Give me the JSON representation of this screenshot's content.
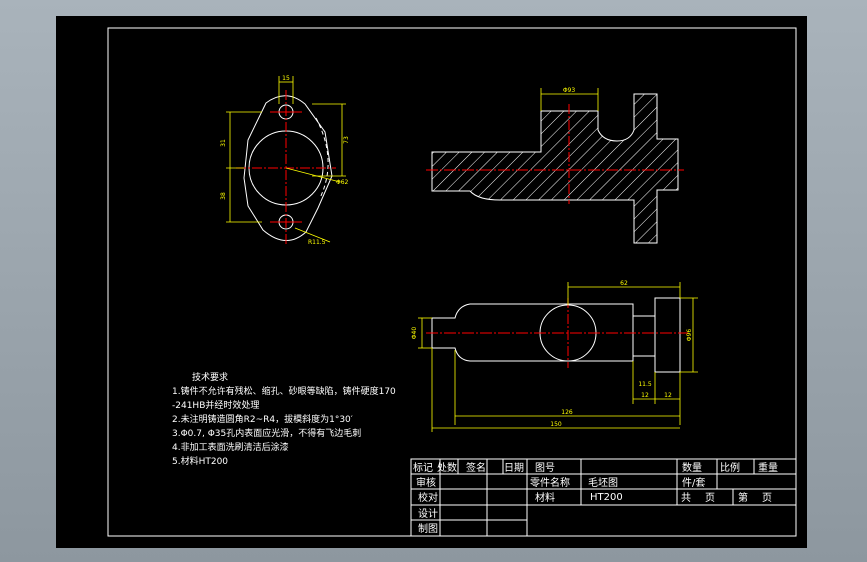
{
  "colors": {
    "paper": "#000000",
    "frame": "#ffffff",
    "hatch": "#ffffff",
    "dim": "#ffff00",
    "center": "#ff0000",
    "text": "#ffffff"
  },
  "dims": {
    "top_width": "15",
    "left_upper": "31",
    "left_lower": "38",
    "right_height": "73",
    "dia_label": "Φ62",
    "r_label": "R11.5",
    "sec_width": "Φ93",
    "top_62": "62",
    "left_dia": "Φ40",
    "right_dia": "Φ96",
    "dim_115": "11.5",
    "dim_12a": "12",
    "dim_12b": "12",
    "dim_126": "126",
    "dim_150": "150"
  },
  "notes": {
    "title": "技术要求",
    "lines": [
      "1.铸件不允许有残松、缩孔、砂眼等缺陷，铸件硬度170",
      "-241HB并经时效处理",
      "2.未注明铸造圆角R2~R4，拔模斜度为1°30′",
      "3.Φ0.7, Φ35孔内表面应光滑，不得有飞边毛刺",
      "4.非加工表面洗刷清洁后涂漆",
      "5.材料HT200"
    ]
  },
  "titleblock": {
    "h_mark": "标记",
    "h_place": "处数",
    "h_sign": "签名",
    "h_date": "日期",
    "r_review": "审核",
    "r_check": "校对",
    "r_design": "设计",
    "r_draw": "制图",
    "drawing_no": "图号",
    "part_name": "零件名称",
    "part_name_value": "毛坯图",
    "material": "材料",
    "material_value": "HT200",
    "qty": "数量",
    "scale": "比例",
    "weight": "重量",
    "pieces": "件/套",
    "total": "共",
    "pages": "页",
    "sheet_no": "第",
    "page": "页"
  }
}
